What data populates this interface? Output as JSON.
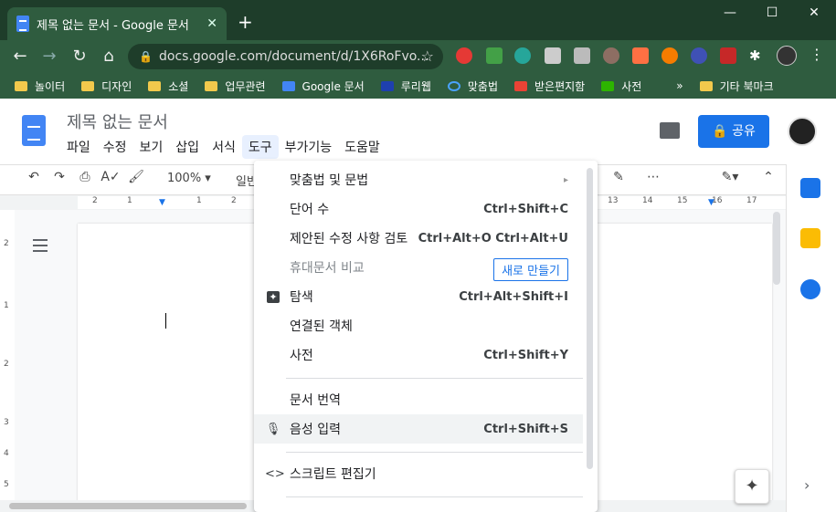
{
  "browser": {
    "tab_title": "제목 없는 문서 - Google 문서",
    "tab_close": "✕",
    "new_tab": "+",
    "url": "docs.google.com/document/d/1X6RoFvo...",
    "bookmarks": [
      "놀이터",
      "디자인",
      "소셜",
      "업무관련",
      "Google 문서",
      "루리웹",
      "맞춤법",
      "받은편지함",
      "사전"
    ],
    "bookmarks_more": "»",
    "bookmarks_other": "기타 북마크"
  },
  "docs": {
    "title": "제목 없는 문서",
    "menus": [
      "파일",
      "수정",
      "보기",
      "삽입",
      "서식",
      "도구",
      "부가기능",
      "도움말"
    ],
    "share_label": "공유",
    "zoom": "100%",
    "style": "일반"
  },
  "ruler": {
    "ticks": [
      "2",
      "1",
      "1",
      "2",
      "13",
      "14",
      "15",
      "16",
      "17"
    ]
  },
  "vruler": {
    "ticks": [
      "2",
      "1",
      "2",
      "3",
      "4",
      "5"
    ]
  },
  "tools_menu": {
    "items": [
      {
        "label": "맞춤법 및 문법",
        "shortcut": "▸"
      },
      {
        "label": "단어 수",
        "shortcut": "Ctrl+Shift+C"
      },
      {
        "label": "제안된 수정 사항 검토",
        "shortcut": "Ctrl+Alt+O Ctrl+Alt+U"
      },
      {
        "label": "휴대문서 비교",
        "button": "새로 만들기"
      },
      {
        "label": "탐색",
        "shortcut": "Ctrl+Alt+Shift+I"
      },
      {
        "label": "연결된 객체",
        "shortcut": ""
      },
      {
        "label": "사전",
        "shortcut": "Ctrl+Shift+Y"
      },
      {
        "label": "문서 번역",
        "shortcut": ""
      },
      {
        "label": "음성 입력",
        "shortcut": "Ctrl+Shift+S"
      },
      {
        "label": "스크립트 편집기",
        "shortcut": ""
      }
    ]
  }
}
